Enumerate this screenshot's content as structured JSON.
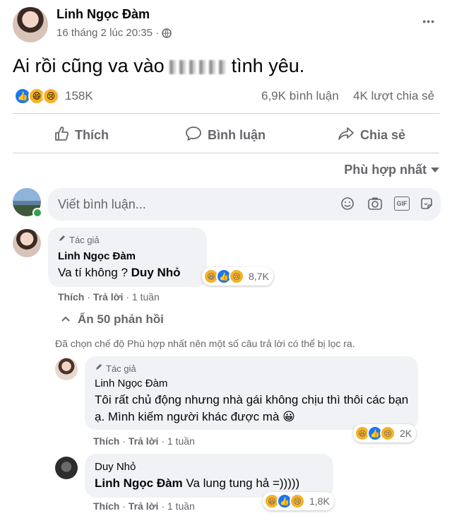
{
  "post": {
    "author": "Linh Ngọc Đàm",
    "timestamp": "16 tháng 2 lúc 20:35 ·",
    "more_glyph": "•••",
    "text_before": "Ai rồi cũng va vào",
    "text_after": "tình yêu.",
    "reactions_count": "158K",
    "comments_count": "6,9K bình luận",
    "shares_count": "4K lượt chia sẻ"
  },
  "actions": {
    "like_label": "Thích",
    "comment_label": "Bình luận",
    "share_label": "Chia sẻ"
  },
  "sort": {
    "label": "Phù hợp nhất"
  },
  "composer": {
    "placeholder": "Viết bình luận...",
    "icons": [
      "smiley-icon",
      "camera-icon",
      "gif-icon",
      "sticker-icon"
    ],
    "gif_text": "GIF"
  },
  "comments": [
    {
      "badge": "Tác giả",
      "author": "Linh Ngọc Đàm",
      "text": "Va tí không ? ",
      "mention": "Duy Nhỏ",
      "reactions_count": "8,7K",
      "like_label": "Thích",
      "reply_label": "Trả lời",
      "time": "· 1 tuần"
    }
  ],
  "hide_replies_label": "Ẩn 50 phản hồi",
  "filter_notice": "Đã chọn chế độ Phù hợp nhất nên một số câu trả lời có thể bị lọc ra.",
  "replies": [
    {
      "badge": "Tác giả",
      "author": "Linh Ngọc Đàm",
      "text": "Tôi rất chủ động nhưng nhà gái không chịu thì thôi các bạn ạ. Mình kiếm người khác được mà 😀",
      "reactions_count": "2K",
      "like_label": "Thích",
      "reply_label": "Trả lời",
      "time": "· 1 tuần"
    },
    {
      "author": "Duy Nhỏ",
      "mention": "Linh Ngọc Đàm",
      "text": " Va lung tung hả =)))))",
      "reactions_count": "1,8K",
      "like_label": "Thích",
      "reply_label": "Trả lời",
      "time": "· 1 tuần"
    }
  ],
  "colors": {
    "accent": "#1877f2",
    "muted": "#65676b",
    "bubble": "#f0f2f5",
    "online": "#31a24c"
  }
}
